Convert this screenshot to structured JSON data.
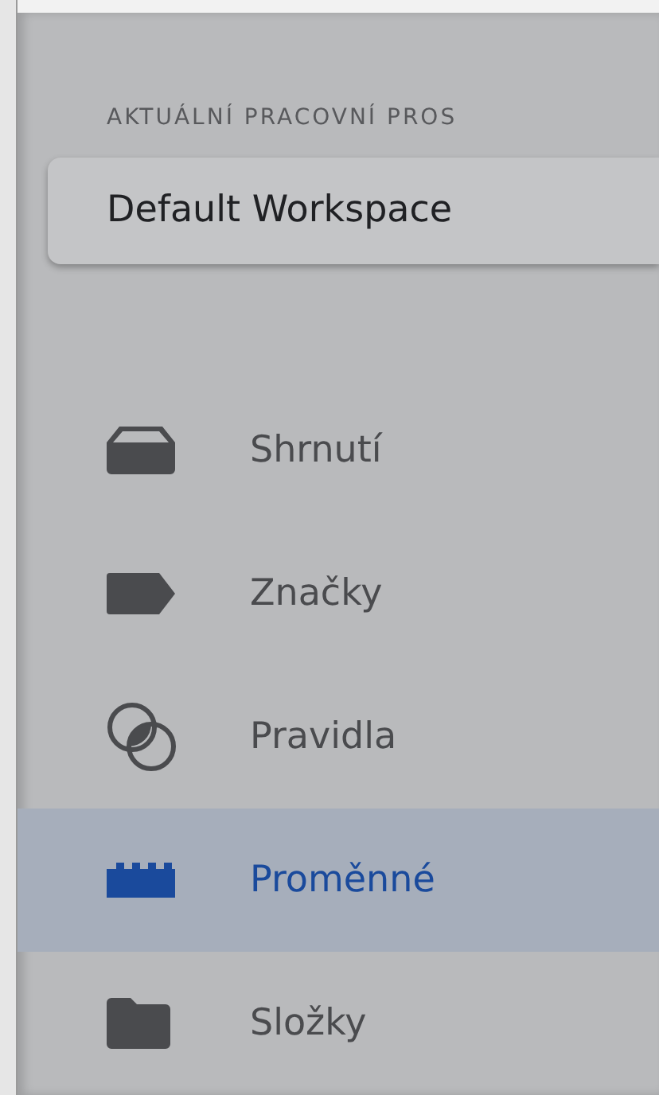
{
  "section_label": "AKTUÁLNÍ PRACOVNÍ PROS",
  "workspace": {
    "name": "Default Workspace"
  },
  "nav_items": [
    {
      "kind": "overview",
      "label": "Shrnutí",
      "selected": false
    },
    {
      "kind": "tags",
      "label": "Značky",
      "selected": false
    },
    {
      "kind": "triggers",
      "label": "Pravidla",
      "selected": false
    },
    {
      "kind": "variables",
      "label": "Proměnné",
      "selected": true
    },
    {
      "kind": "folders",
      "label": "Složky",
      "selected": false
    }
  ]
}
